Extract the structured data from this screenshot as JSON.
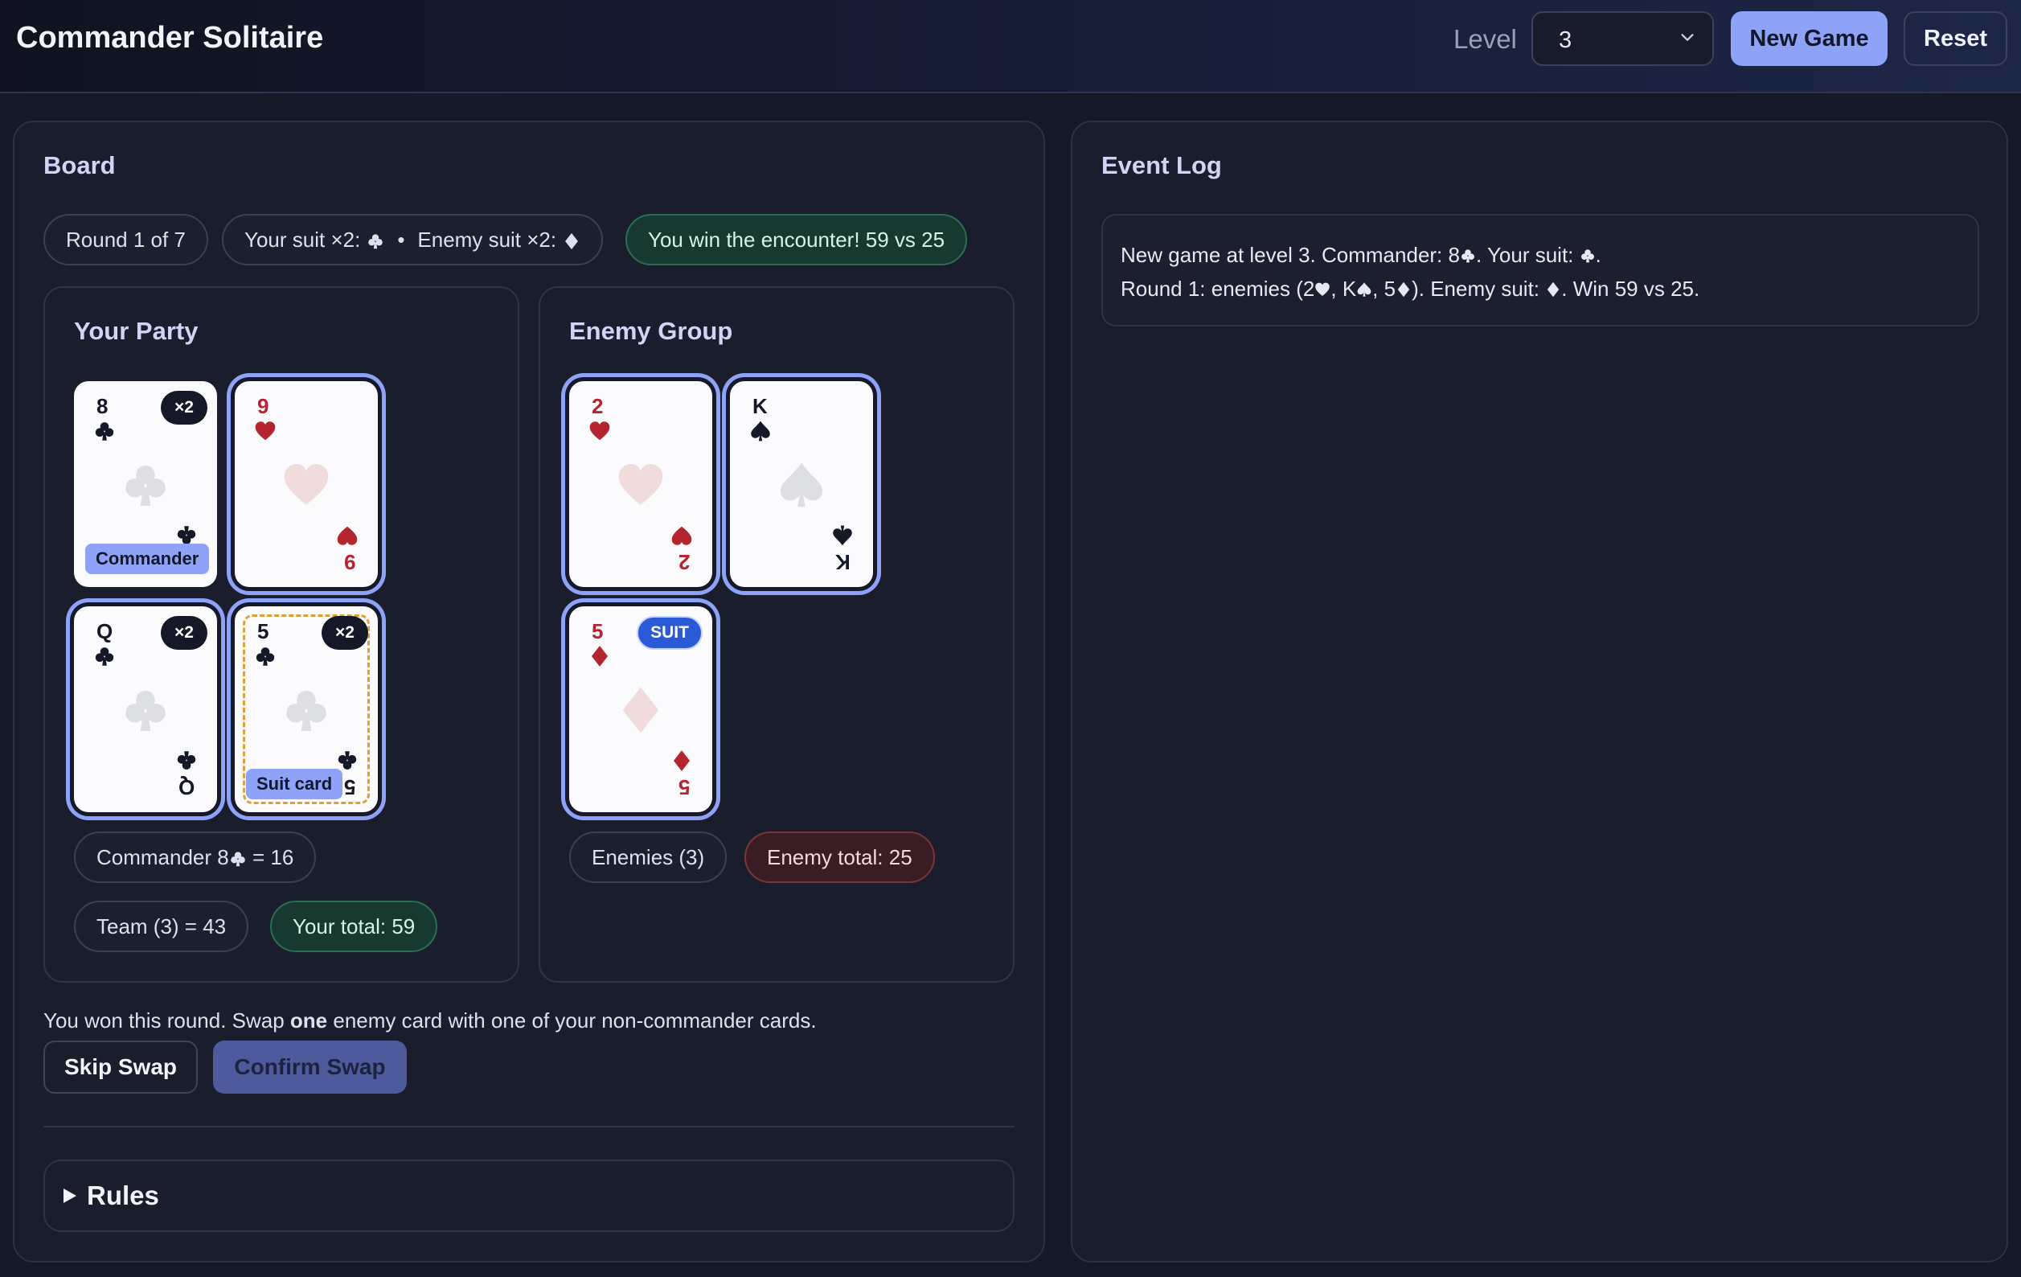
{
  "header": {
    "title": "Commander Solitaire",
    "level_label": "Level",
    "level_value": "3",
    "new_game_label": "New Game",
    "reset_label": "Reset"
  },
  "board": {
    "title": "Board",
    "round_chip": "Round 1 of 7",
    "suits_chip": {
      "your_text": "Your suit ×2:",
      "your_suit": "clubs",
      "separator": "•",
      "enemy_text": "Enemy suit ×2:",
      "enemy_suit": "diamonds"
    },
    "result_chip": "You win the encounter! 59 vs 25"
  },
  "party": {
    "title": "Your Party",
    "cards": [
      {
        "rank": "8",
        "suit": "clubs",
        "color": "black",
        "badge": "×2",
        "tag": "Commander",
        "selected": false
      },
      {
        "rank": "9",
        "suit": "hearts",
        "color": "red",
        "badge": "",
        "tag": "",
        "selected": true
      },
      {
        "rank": "Q",
        "suit": "clubs",
        "color": "black",
        "badge": "×2",
        "tag": "",
        "selected": true
      },
      {
        "rank": "5",
        "suit": "clubs",
        "color": "black",
        "badge": "×2",
        "tag": "Suit card",
        "selected": true
      }
    ],
    "commander_chip": {
      "text_before": "Commander 8",
      "suit": "clubs",
      "text_after": " = 16"
    },
    "team_chip": "Team (3) = 43",
    "total_chip": "Your total: 59"
  },
  "enemy": {
    "title": "Enemy Group",
    "cards": [
      {
        "rank": "2",
        "suit": "hearts",
        "color": "red",
        "badge": "",
        "selected": true
      },
      {
        "rank": "K",
        "suit": "spades",
        "color": "black",
        "badge": "",
        "selected": true
      },
      {
        "rank": "5",
        "suit": "diamonds",
        "color": "red",
        "badge": "SUIT",
        "selected": true
      }
    ],
    "count_chip": "Enemies (3)",
    "total_chip": "Enemy total: 25"
  },
  "actions": {
    "help_before": "You won this round. Swap ",
    "help_bold": "one",
    "help_after": " enemy card with one of your non-commander cards.",
    "skip_label": "Skip Swap",
    "confirm_label": "Confirm Swap"
  },
  "rules": {
    "label": "Rules"
  },
  "event_log": {
    "title": "Event Log",
    "line1": {
      "a": "New game at level 3. Commander: 8",
      "suit1": "clubs",
      "b": ". Your suit: ",
      "suit2": "clubs",
      "c": "."
    },
    "line2": {
      "a": "Round 1: enemies (2",
      "s1": "hearts",
      "b": ", K",
      "s2": "spades",
      "c": ", 5",
      "s3": "diamonds",
      "d": "). Enemy suit: ",
      "s4": "diamonds",
      "e": ". Win 59 vs 25."
    }
  },
  "colors": {
    "accent": "#8ea2f7",
    "win_chip_bg": "#173a30",
    "loss_chip_bg": "#3a1c24",
    "card_red": "#b3262f",
    "card_black": "#151826",
    "suit_badge": "#2a5ad6",
    "suit_card_dash": "#e0a030"
  }
}
